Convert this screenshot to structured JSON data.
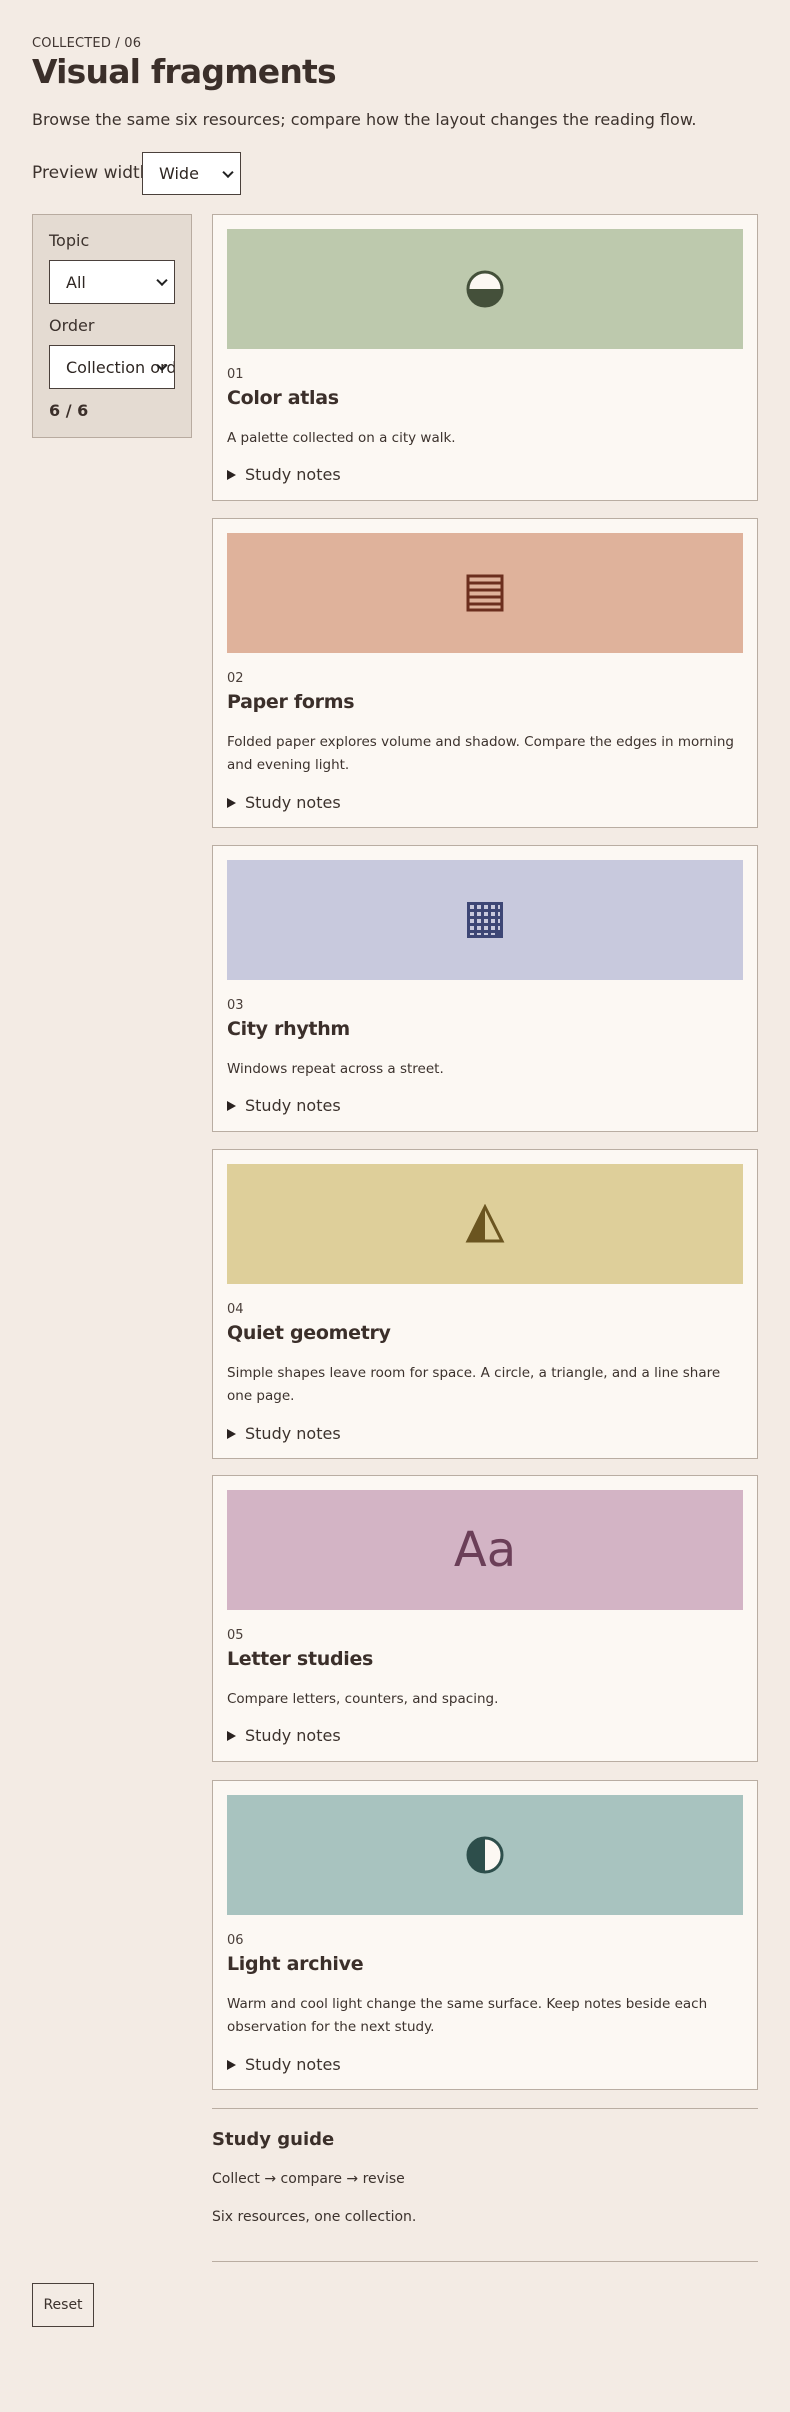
{
  "header": {
    "eyebrow": "COLLECTED / 06",
    "title": "Visual fragments",
    "intro": "Browse the same six resources; compare how the layout changes the reading flow."
  },
  "preview": {
    "label": "Preview width",
    "value": "Wide"
  },
  "filters": {
    "topic_label": "Topic",
    "topic_value": "All",
    "order_label": "Order",
    "order_value": "Collection order",
    "count": "6 / 6"
  },
  "cards": [
    {
      "num": "01",
      "title": "Color atlas",
      "desc": "A palette collected on a city walk.",
      "notes": "Study notes",
      "bg": "#bdc9ad",
      "icon": "half-circle-icon"
    },
    {
      "num": "02",
      "title": "Paper forms",
      "desc": "Folded paper explores volume and shadow. Compare the edges in morning and evening light.",
      "notes": "Study notes",
      "bg": "#dfb29b",
      "icon": "lines-icon"
    },
    {
      "num": "03",
      "title": "City rhythm",
      "desc": "Windows repeat across a street.",
      "notes": "Study notes",
      "bg": "#c8c9dd",
      "icon": "grid-icon"
    },
    {
      "num": "04",
      "title": "Quiet geometry",
      "desc": "Simple shapes leave room for space. A circle, a triangle, and a line share one page.",
      "notes": "Study notes",
      "bg": "#decf9a",
      "icon": "triangle-icon"
    },
    {
      "num": "05",
      "title": "Letter studies",
      "desc": "Compare letters, counters, and spacing.",
      "notes": "Study notes",
      "bg": "#d3b4c5",
      "icon": "letters-icon",
      "glyph": "Aa"
    },
    {
      "num": "06",
      "title": "Light archive",
      "desc": "Warm and cool light change the same surface. Keep notes beside each observation for the next study.",
      "notes": "Study notes",
      "bg": "#a8c3bf",
      "icon": "half-moon-icon"
    }
  ],
  "guide": {
    "title": "Study guide",
    "line1": "Collect → compare → revise",
    "line2": "Six resources, one collection."
  },
  "reset_label": "Reset"
}
